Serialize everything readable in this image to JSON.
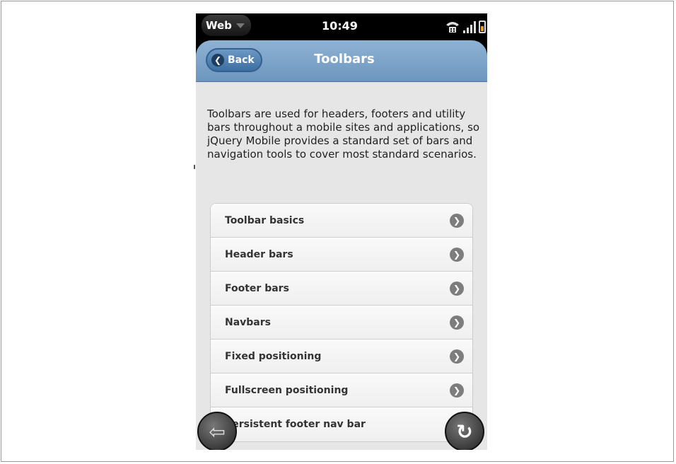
{
  "statusbar": {
    "app_menu_label": "Web",
    "time": "10:49",
    "icons": [
      "phone-signal-icon",
      "signal-bars-icon",
      "battery-charging-icon"
    ]
  },
  "header": {
    "back_label": "Back",
    "back_icon": "chevron-left-icon",
    "title": "Toolbars"
  },
  "intro_text": "Toolbars are used for headers, footers and utility bars throughout a mobile sites and applications, so jQuery Mobile provides a standard set of bars and navigation tools to cover most standard scenarios.",
  "list": {
    "items": [
      {
        "label": "Toolbar basics"
      },
      {
        "label": "Header bars"
      },
      {
        "label": "Footer bars"
      },
      {
        "label": "Navbars"
      },
      {
        "label": "Fixed positioning"
      },
      {
        "label": "Fullscreen positioning"
      },
      {
        "label": "Persistent footer nav bar"
      }
    ],
    "item_icon": "chevron-right-circle-icon"
  },
  "floating_controls": {
    "back_icon": "back-arrow-icon",
    "reload_icon": "reload-icon"
  },
  "colors": {
    "header_blue": "#7ea5cb",
    "content_bg": "#e6e6e6",
    "list_bg": "#f6f6f6"
  }
}
